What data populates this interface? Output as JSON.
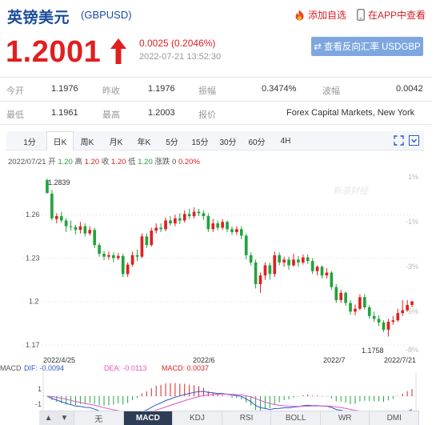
{
  "header": {
    "title": "英镑美元",
    "code": "(GBPUSD)",
    "add_fav": "添加自选",
    "app_quote": "在APP中查看"
  },
  "quote": {
    "price": "1.2001",
    "change": "0.0025 (0.2046%)",
    "time": "2022-07-21 13:52:30",
    "reverse_button": "查看反向汇率 USDGBP"
  },
  "stats": {
    "open_label": "今开",
    "open": "1.1976",
    "prev_label": "昨收",
    "prev": "1.1976",
    "amp_label": "振幅",
    "amp": "0.3474%",
    "wave_label": "波幅",
    "wave": "0.0042",
    "low_label": "最低",
    "low": "1.1961",
    "high_label": "最高",
    "high": "1.2003",
    "quote_label": "报价",
    "quote_src": "Forex Capital Markets, New York"
  },
  "chart_tabs": [
    "1分",
    "日K",
    "周K",
    "月K",
    "年K",
    "5分",
    "15分",
    "30分",
    "60分",
    "4H"
  ],
  "active_chart_tab": "日K",
  "ohlc_bar": {
    "date": "2022/07/21",
    "open_label": "开",
    "open": "1.20",
    "high_label": "高",
    "high": "1.20",
    "close_label": "收",
    "close": "1.20",
    "low_label": "低",
    "low": "1.20",
    "chg_label": "涨跌",
    "chg": "0",
    "pct": "0.20%"
  },
  "chart_data": {
    "type": "candlestick",
    "title": "",
    "y_ticks": [
      "1.26",
      "1.23",
      "1.2",
      "1.17"
    ],
    "y_tick_values": [
      1.26,
      1.23,
      1.2,
      1.17
    ],
    "right_ticks": [
      "1%",
      "-1%",
      "-3%",
      "-5%",
      "-8%"
    ],
    "x_labels": [
      "2022/4/25",
      "2022/6",
      "2022/7",
      "2022/7/21"
    ],
    "ylim": [
      1.165,
      1.29
    ],
    "max_label": "1.2839",
    "min_label": "1.1758",
    "watermark": "新浪财经",
    "candles": [
      [
        1.2839,
        1.275,
        1.285,
        1.2745
      ],
      [
        1.2745,
        1.2575,
        1.277,
        1.256
      ],
      [
        1.257,
        1.259,
        1.261,
        1.254
      ],
      [
        1.259,
        1.256,
        1.262,
        1.2545
      ],
      [
        1.256,
        1.252,
        1.2575,
        1.248
      ],
      [
        1.252,
        1.2515,
        1.256,
        1.249
      ],
      [
        1.2515,
        1.2495,
        1.253,
        1.2465
      ],
      [
        1.2495,
        1.252,
        1.255,
        1.247
      ],
      [
        1.252,
        1.247,
        1.254,
        1.245
      ],
      [
        1.247,
        1.2495,
        1.252,
        1.2455
      ],
      [
        1.2495,
        1.239,
        1.251,
        1.237
      ],
      [
        1.239,
        1.233,
        1.2405,
        1.231
      ],
      [
        1.233,
        1.231,
        1.235,
        1.2285
      ],
      [
        1.231,
        1.232,
        1.2345,
        1.229
      ],
      [
        1.232,
        1.23,
        1.234,
        1.227
      ],
      [
        1.23,
        1.2315,
        1.2335,
        1.2285
      ],
      [
        1.2315,
        1.219,
        1.233,
        1.217
      ],
      [
        1.219,
        1.2255,
        1.227,
        1.217
      ],
      [
        1.2255,
        1.232,
        1.2345,
        1.224
      ],
      [
        1.232,
        1.231,
        1.236,
        1.228
      ],
      [
        1.231,
        1.245,
        1.247,
        1.23
      ],
      [
        1.245,
        1.239,
        1.247,
        1.237
      ],
      [
        1.239,
        1.249,
        1.251,
        1.238
      ],
      [
        1.249,
        1.251,
        1.254,
        1.247
      ],
      [
        1.251,
        1.25,
        1.254,
        1.248
      ],
      [
        1.25,
        1.256,
        1.258,
        1.2485
      ],
      [
        1.256,
        1.254,
        1.259,
        1.2525
      ],
      [
        1.254,
        1.2575,
        1.26,
        1.252
      ],
      [
        1.2575,
        1.256,
        1.261,
        1.2535
      ],
      [
        1.256,
        1.2605,
        1.263,
        1.2545
      ],
      [
        1.2605,
        1.259,
        1.264,
        1.257
      ],
      [
        1.259,
        1.262,
        1.265,
        1.2575
      ],
      [
        1.262,
        1.261,
        1.264,
        1.259
      ],
      [
        1.261,
        1.259,
        1.263,
        1.2565
      ],
      [
        1.259,
        1.25,
        1.261,
        1.248
      ],
      [
        1.25,
        1.254,
        1.257,
        1.248
      ],
      [
        1.254,
        1.251,
        1.256,
        1.249
      ],
      [
        1.251,
        1.255,
        1.257,
        1.2495
      ],
      [
        1.255,
        1.25,
        1.256,
        1.248
      ],
      [
        1.25,
        1.248,
        1.252,
        1.246
      ],
      [
        1.248,
        1.25,
        1.252,
        1.246
      ],
      [
        1.25,
        1.2455,
        1.252,
        1.243
      ],
      [
        1.2455,
        1.232,
        1.247,
        1.229
      ],
      [
        1.232,
        1.227,
        1.234,
        1.225
      ],
      [
        1.227,
        1.212,
        1.229,
        1.209
      ],
      [
        1.212,
        1.218,
        1.22,
        1.206
      ],
      [
        1.218,
        1.225,
        1.227,
        1.215
      ],
      [
        1.225,
        1.219,
        1.227,
        1.215
      ],
      [
        1.219,
        1.232,
        1.2345,
        1.217
      ],
      [
        1.232,
        1.227,
        1.234,
        1.225
      ],
      [
        1.227,
        1.229,
        1.231,
        1.224
      ],
      [
        1.229,
        1.225,
        1.231,
        1.222
      ],
      [
        1.225,
        1.229,
        1.233,
        1.224
      ],
      [
        1.229,
        1.227,
        1.2315,
        1.224
      ],
      [
        1.227,
        1.2305,
        1.2325,
        1.2255
      ],
      [
        1.2305,
        1.228,
        1.2325,
        1.226
      ],
      [
        1.228,
        1.221,
        1.23,
        1.219
      ],
      [
        1.221,
        1.224,
        1.225,
        1.218
      ],
      [
        1.224,
        1.218,
        1.225,
        1.216
      ],
      [
        1.218,
        1.22,
        1.223,
        1.216
      ],
      [
        1.22,
        1.21,
        1.221,
        1.208
      ],
      [
        1.21,
        1.201,
        1.212,
        1.199
      ],
      [
        1.201,
        1.206,
        1.208,
        1.199
      ],
      [
        1.206,
        1.199,
        1.207,
        1.197
      ],
      [
        1.199,
        1.193,
        1.201,
        1.191
      ],
      [
        1.193,
        1.195,
        1.198,
        1.1905
      ],
      [
        1.195,
        1.203,
        1.205,
        1.194
      ],
      [
        1.203,
        1.196,
        1.205,
        1.1945
      ],
      [
        1.196,
        1.19,
        1.1975,
        1.188
      ],
      [
        1.19,
        1.188,
        1.193,
        1.186
      ],
      [
        1.188,
        1.1855,
        1.1905,
        1.183
      ],
      [
        1.1855,
        1.1805,
        1.187,
        1.179
      ],
      [
        1.1805,
        1.186,
        1.188,
        1.1758
      ],
      [
        1.186,
        1.187,
        1.19,
        1.184
      ],
      [
        1.187,
        1.192,
        1.195,
        1.186
      ],
      [
        1.192,
        1.194,
        1.201,
        1.19
      ],
      [
        1.194,
        1.1976,
        1.201,
        1.193
      ],
      [
        1.1976,
        1.2001,
        1.2003,
        1.1961
      ]
    ]
  },
  "macd": {
    "label": "MACD",
    "dif": "DIF: -0.0094",
    "dea": "DEA: -0.0113",
    "macd": "MACD: 0.0037",
    "axis_top": "1",
    "axis_bottom": "-1",
    "up_arrow": "▲",
    "down_arrow": "▼",
    "tabs": [
      "无",
      "MACD",
      "KDJ",
      "RSI",
      "BOLL",
      "WR",
      "DMI"
    ],
    "active_tab": "MACD"
  },
  "colors": {
    "up": "#e02020",
    "down": "#23a33d",
    "brand_blue": "#1a4b9c",
    "button_blue": "#7ea7e0",
    "dif_line": "#2d57c8",
    "dea_line": "#e155c8",
    "macd_text": "#e02020"
  }
}
